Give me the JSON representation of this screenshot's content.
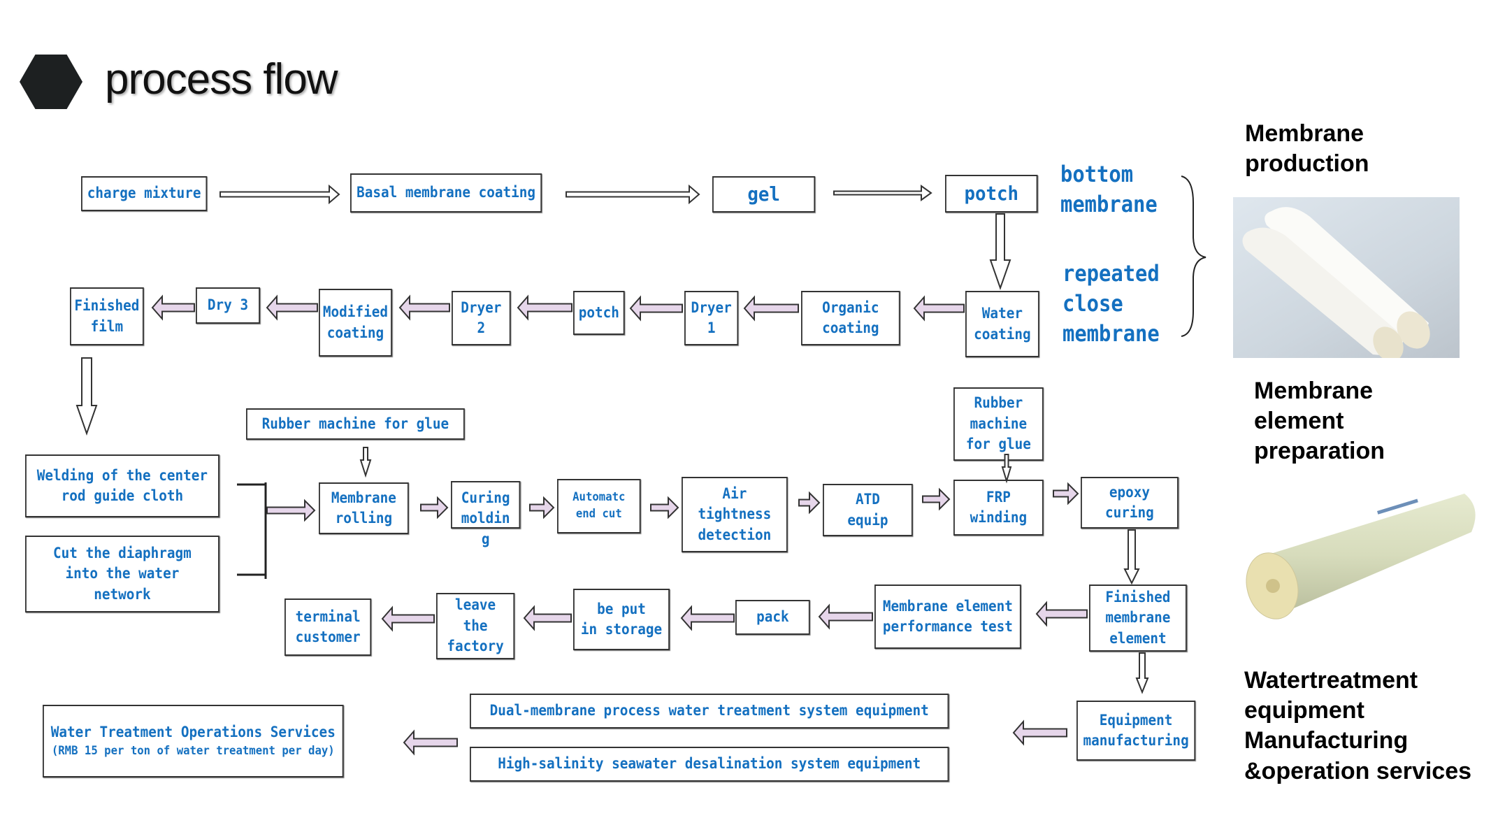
{
  "header": {
    "title": "process flow",
    "bullet_icon": "hexagon-icon"
  },
  "colors": {
    "accent_text": "#1470c0",
    "arrow_fill": "#e6d6ea",
    "box_border": "#333333",
    "title": "#111111"
  },
  "membrane_production": {
    "row1": [
      "charge mixture",
      "Basal membrane coating",
      "gel",
      "potch"
    ],
    "row2": [
      "Water\ncoating",
      "Organic\ncoating",
      "Dryer\n1",
      "potch",
      "Dryer\n2",
      "Modified\ncoating",
      "Dry 3",
      "Finished\nfilm"
    ],
    "notes": {
      "bottom": "bottom\nmembrane",
      "repeated": "repeated\nclose\nmembrane"
    }
  },
  "element_preparation": {
    "inputs": [
      "Welding of the center\nrod guide cloth",
      "Cut the diaphragm\ninto the water\nnetwork"
    ],
    "rubber_glue_top": "Rubber machine for glue",
    "rubber_glue_side": "Rubber\nmachine\nfor glue",
    "row3": [
      "Membrane\nrolling",
      "Curing\nmoldin\ng",
      "Automatc\nend cut",
      "Air\ntightness\ndetection",
      "ATD\nequip",
      "FRP\nwinding",
      "epoxy\ncuring"
    ],
    "row4": [
      "Finished\nmembrane\nelement",
      "Membrane element\nperformance test",
      "pack",
      "be put\nin storage",
      "leave\nthe\nfactory",
      "terminal\ncustomer"
    ]
  },
  "equipment": {
    "manufacturing": "Equipment\nmanufacturing",
    "systems": [
      "Dual-membrane process water treatment system equipment",
      "High-salinity seawater desalination system equipment"
    ],
    "services_title": "Water Treatment Operations Services",
    "services_note": "(RMB 15 per ton of water treatment per day)"
  },
  "sidebar": {
    "sections": [
      {
        "label": "Membrane\nproduction",
        "image": "membrane-rolls-photo"
      },
      {
        "label": "Membrane\nelement\npreparation",
        "image": "membrane-element-photo"
      },
      {
        "label": "Watertreatment\nequipment\nManufacturing\n&operation services"
      }
    ]
  }
}
